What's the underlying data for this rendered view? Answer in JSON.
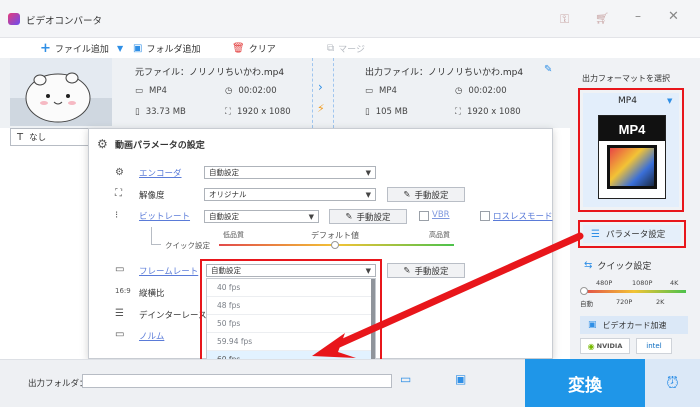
{
  "app": {
    "title": "ビデオコンバータ"
  },
  "toolbar": {
    "add_file": "ファイル追加",
    "add_folder": "フォルダ追加",
    "clear": "クリア",
    "merge": "マージ"
  },
  "file": {
    "source_label": "元ファイル：ノリノリちいかわ.mp4",
    "output_label": "出力ファイル：ノリノリちいかわ.mp4",
    "src_format": "MP4",
    "src_duration": "00:02:00",
    "src_size": "33.73 MB",
    "src_resolution": "1920 x 1080",
    "out_format": "MP4",
    "out_duration": "00:02:00",
    "out_size": "105 MB",
    "out_resolution": "1920 x 1080"
  },
  "subtitle": {
    "value": "なし"
  },
  "right": {
    "format_heading": "出力フォーマットを選択",
    "format_value": "MP4",
    "param_button": "パラメータ設定",
    "quick_heading": "クイック設定",
    "ticks_top": [
      "480P",
      "1080P",
      "4K"
    ],
    "ticks_bottom": [
      "自動",
      "720P",
      "2K"
    ],
    "gpu_button": "ビデオカード加速",
    "nvidia": "NVIDIA",
    "intel": "intel"
  },
  "dialog": {
    "title": "動画パラメータの設定",
    "encoder_label": "エンコーダ",
    "encoder_value": "自動設定",
    "resolution_label": "解像度",
    "resolution_value": "オリジナル",
    "manual": "手動設定",
    "bitrate_label": "ビットレート",
    "bitrate_value": "自動設定",
    "vbr": "VBR",
    "lossless": "ロスレスモード",
    "quick_label": "クイック設定",
    "low": "低品質",
    "default": "デフォルト値",
    "high": "高品質",
    "framerate_label": "フレームレート",
    "framerate_value": "自動設定",
    "aspect_label": "縦横比",
    "deinterlace_label": "デインターレース",
    "normal_label": "ノルム",
    "fps_options": [
      "40 fps",
      "48 fps",
      "50 fps",
      "59.94 fps",
      "60 fps"
    ]
  },
  "bottom": {
    "folder_label": "出力フォルダ：",
    "convert": "変換"
  },
  "colors": {
    "accent": "#2f8fe6",
    "highlight": "#e8161b",
    "convert_bg": "#1f96e8"
  }
}
